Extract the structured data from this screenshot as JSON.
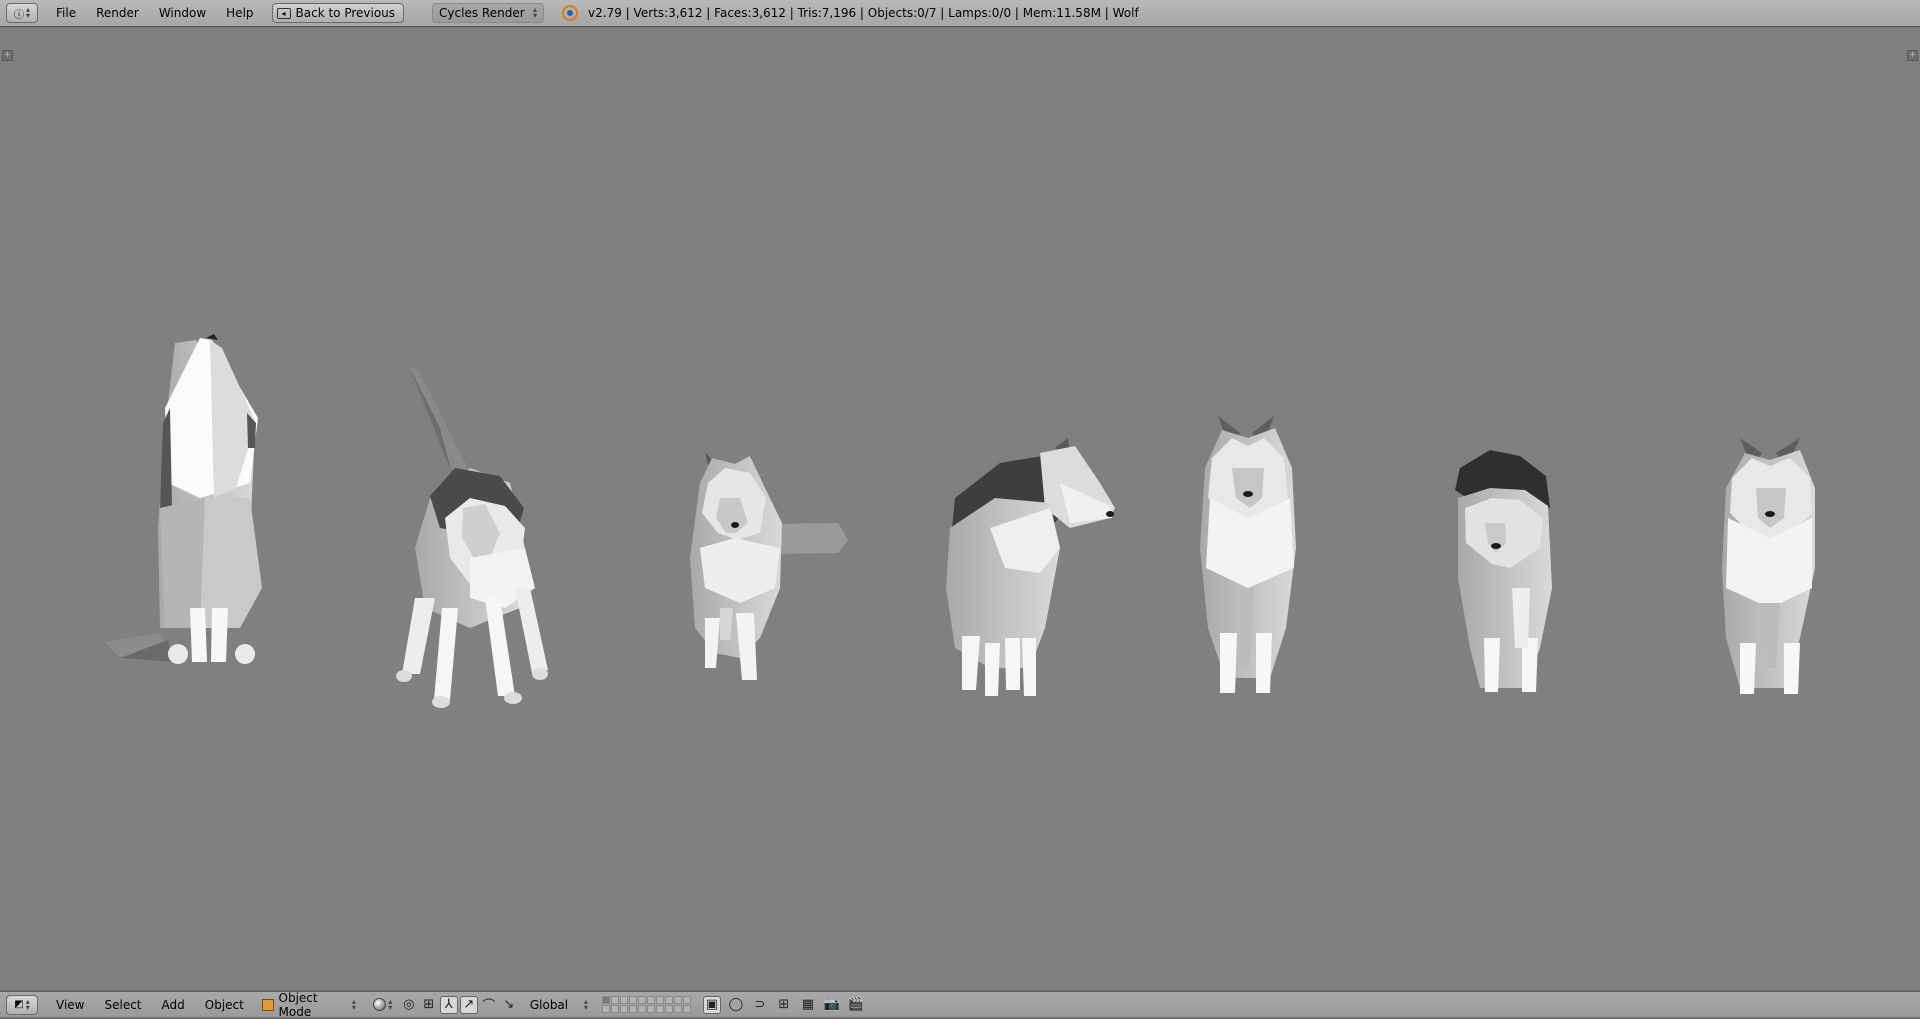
{
  "topbar": {
    "menu": [
      "File",
      "Render",
      "Window",
      "Help"
    ],
    "back_label": "Back to Previous",
    "render_engine": "Cycles Render",
    "stats": "v2.79 | Verts:3,612 | Faces:3,612 | Tris:7,196 | Objects:0/7 | Lamps:0/0 | Mem:11.58M | Wolf"
  },
  "viewport": {
    "background": "#808080",
    "wolves": [
      "Sitting howling",
      "Walking tail up",
      "Running",
      "Looking sideways",
      "Standing front",
      "Walking head down",
      "Standing front"
    ]
  },
  "bottombar": {
    "menu": [
      "View",
      "Select",
      "Add",
      "Object"
    ],
    "mode": "Object Mode",
    "orientation": "Global"
  }
}
